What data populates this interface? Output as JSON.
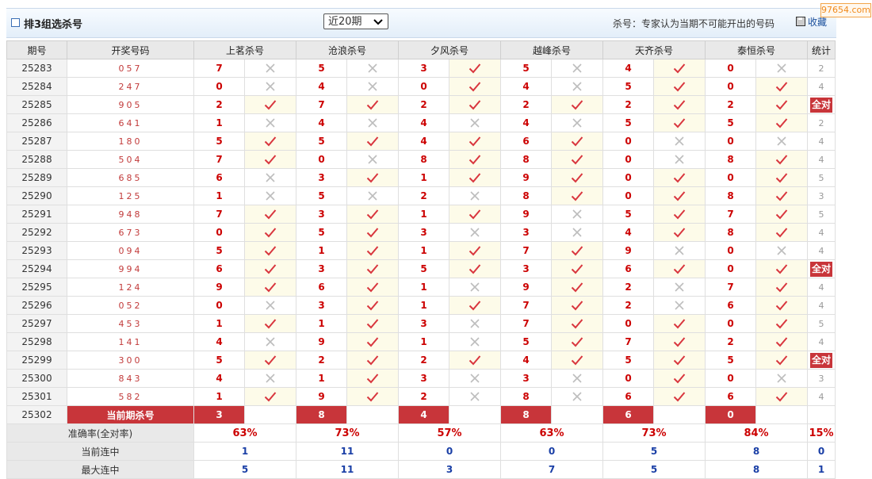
{
  "header": {
    "title": "排3组选杀号",
    "period_select": "近20期",
    "note": "杀号：专家认为当期不可能开出的号码",
    "favorite_label": "收藏",
    "watermark": "97654.com"
  },
  "columns": {
    "period": "期号",
    "draw": "开奖号码",
    "experts": [
      "上茗杀号",
      "沧浪杀号",
      "夕风杀号",
      "越峰杀号",
      "天齐杀号",
      "泰恒杀号"
    ],
    "stat": "统计"
  },
  "rows": [
    {
      "period": "25283",
      "draw": "057",
      "kills": [
        [
          "7",
          false
        ],
        [
          "5",
          false
        ],
        [
          "3",
          true
        ],
        [
          "5",
          false
        ],
        [
          "4",
          true
        ],
        [
          "0",
          false
        ]
      ],
      "stat": "2"
    },
    {
      "period": "25284",
      "draw": "247",
      "kills": [
        [
          "0",
          false
        ],
        [
          "4",
          false
        ],
        [
          "0",
          true
        ],
        [
          "4",
          false
        ],
        [
          "5",
          true
        ],
        [
          "0",
          true
        ]
      ],
      "stat": "4"
    },
    {
      "period": "25285",
      "draw": "905",
      "kills": [
        [
          "2",
          true
        ],
        [
          "7",
          true
        ],
        [
          "2",
          true
        ],
        [
          "2",
          true
        ],
        [
          "2",
          true
        ],
        [
          "2",
          true
        ]
      ],
      "stat": "全对"
    },
    {
      "period": "25286",
      "draw": "641",
      "kills": [
        [
          "1",
          false
        ],
        [
          "4",
          false
        ],
        [
          "4",
          false
        ],
        [
          "4",
          false
        ],
        [
          "5",
          true
        ],
        [
          "5",
          true
        ]
      ],
      "stat": "2"
    },
    {
      "period": "25287",
      "draw": "180",
      "kills": [
        [
          "5",
          true
        ],
        [
          "5",
          true
        ],
        [
          "4",
          true
        ],
        [
          "6",
          true
        ],
        [
          "0",
          false
        ],
        [
          "0",
          false
        ]
      ],
      "stat": "4"
    },
    {
      "period": "25288",
      "draw": "504",
      "kills": [
        [
          "7",
          true
        ],
        [
          "0",
          false
        ],
        [
          "8",
          true
        ],
        [
          "8",
          true
        ],
        [
          "0",
          false
        ],
        [
          "8",
          true
        ]
      ],
      "stat": "4"
    },
    {
      "period": "25289",
      "draw": "685",
      "kills": [
        [
          "6",
          false
        ],
        [
          "3",
          true
        ],
        [
          "1",
          true
        ],
        [
          "9",
          true
        ],
        [
          "0",
          true
        ],
        [
          "0",
          true
        ]
      ],
      "stat": "5"
    },
    {
      "period": "25290",
      "draw": "125",
      "kills": [
        [
          "1",
          false
        ],
        [
          "5",
          false
        ],
        [
          "2",
          false
        ],
        [
          "8",
          true
        ],
        [
          "0",
          true
        ],
        [
          "8",
          true
        ]
      ],
      "stat": "3"
    },
    {
      "period": "25291",
      "draw": "948",
      "kills": [
        [
          "7",
          true
        ],
        [
          "3",
          true
        ],
        [
          "1",
          true
        ],
        [
          "9",
          false
        ],
        [
          "5",
          true
        ],
        [
          "7",
          true
        ]
      ],
      "stat": "5"
    },
    {
      "period": "25292",
      "draw": "673",
      "kills": [
        [
          "0",
          true
        ],
        [
          "5",
          true
        ],
        [
          "3",
          false
        ],
        [
          "3",
          false
        ],
        [
          "4",
          true
        ],
        [
          "8",
          true
        ]
      ],
      "stat": "4"
    },
    {
      "period": "25293",
      "draw": "094",
      "kills": [
        [
          "5",
          true
        ],
        [
          "1",
          true
        ],
        [
          "1",
          true
        ],
        [
          "7",
          true
        ],
        [
          "9",
          false
        ],
        [
          "0",
          false
        ]
      ],
      "stat": "4"
    },
    {
      "period": "25294",
      "draw": "994",
      "kills": [
        [
          "6",
          true
        ],
        [
          "3",
          true
        ],
        [
          "5",
          true
        ],
        [
          "3",
          true
        ],
        [
          "6",
          true
        ],
        [
          "0",
          true
        ]
      ],
      "stat": "全对"
    },
    {
      "period": "25295",
      "draw": "124",
      "kills": [
        [
          "9",
          true
        ],
        [
          "6",
          true
        ],
        [
          "1",
          false
        ],
        [
          "9",
          true
        ],
        [
          "2",
          false
        ],
        [
          "7",
          true
        ]
      ],
      "stat": "4"
    },
    {
      "period": "25296",
      "draw": "052",
      "kills": [
        [
          "0",
          false
        ],
        [
          "3",
          true
        ],
        [
          "1",
          true
        ],
        [
          "7",
          true
        ],
        [
          "2",
          false
        ],
        [
          "6",
          true
        ]
      ],
      "stat": "4"
    },
    {
      "period": "25297",
      "draw": "453",
      "kills": [
        [
          "1",
          true
        ],
        [
          "1",
          true
        ],
        [
          "3",
          false
        ],
        [
          "7",
          true
        ],
        [
          "0",
          true
        ],
        [
          "0",
          true
        ]
      ],
      "stat": "5"
    },
    {
      "period": "25298",
      "draw": "141",
      "kills": [
        [
          "4",
          false
        ],
        [
          "9",
          true
        ],
        [
          "1",
          false
        ],
        [
          "5",
          true
        ],
        [
          "7",
          true
        ],
        [
          "2",
          true
        ]
      ],
      "stat": "4"
    },
    {
      "period": "25299",
      "draw": "300",
      "kills": [
        [
          "5",
          true
        ],
        [
          "2",
          true
        ],
        [
          "2",
          true
        ],
        [
          "4",
          true
        ],
        [
          "5",
          true
        ],
        [
          "5",
          true
        ]
      ],
      "stat": "全对"
    },
    {
      "period": "25300",
      "draw": "843",
      "kills": [
        [
          "4",
          false
        ],
        [
          "1",
          true
        ],
        [
          "3",
          false
        ],
        [
          "3",
          false
        ],
        [
          "0",
          true
        ],
        [
          "0",
          false
        ]
      ],
      "stat": "3"
    },
    {
      "period": "25301",
      "draw": "582",
      "kills": [
        [
          "1",
          true
        ],
        [
          "9",
          true
        ],
        [
          "2",
          false
        ],
        [
          "8",
          false
        ],
        [
          "6",
          true
        ],
        [
          "6",
          true
        ]
      ],
      "stat": "4"
    }
  ],
  "current": {
    "period": "25302",
    "label": "当前期杀号",
    "kills": [
      "3",
      "8",
      "4",
      "8",
      "6",
      "0"
    ]
  },
  "summary": {
    "rate_label": "准确率(全对率)",
    "rates": [
      "63%",
      "73%",
      "57%",
      "63%",
      "73%",
      "84%"
    ],
    "full_rate": "15%",
    "streak_label": "当前连中",
    "streaks": [
      "1",
      "11",
      "0",
      "0",
      "5",
      "8"
    ],
    "streak_total": "0",
    "max_label": "最大连中",
    "max": [
      "5",
      "11",
      "3",
      "7",
      "5",
      "8"
    ],
    "max_total": "1"
  },
  "icons": {
    "hit": "check-icon",
    "miss": "cross-icon"
  },
  "colors": {
    "accent_red": "#c8353a",
    "check": "#d9363e",
    "cross": "#bdbdbd",
    "hit_bg": "#fdfbe9",
    "header_bg": "#e9e9e9",
    "summary_blue": "#1a3fa6"
  }
}
